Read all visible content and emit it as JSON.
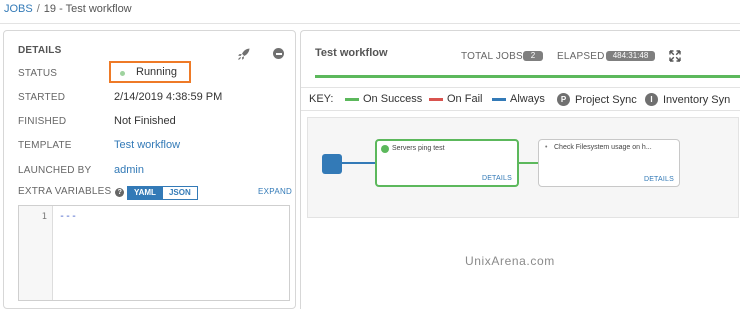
{
  "breadcrumb": {
    "root": "JOBS",
    "separator": "/",
    "current": "19 - Test workflow"
  },
  "details": {
    "title": "DETAILS",
    "status_label": "STATUS",
    "status_value": "Running",
    "started_label": "STARTED",
    "started_value": "2/14/2019 4:38:59 PM",
    "finished_label": "FINISHED",
    "finished_value": "Not Finished",
    "template_label": "TEMPLATE",
    "template_value": "Test workflow",
    "launched_by_label": "LAUNCHED BY",
    "launched_by_value": "admin",
    "extra_vars_label": "EXTRA VARIABLES",
    "help_glyph": "?",
    "yaml_label": "YAML",
    "json_label": "JSON",
    "expand_label": "EXPAND",
    "code_line_number": "1",
    "code_content": "---"
  },
  "workflow": {
    "title": "Test workflow",
    "total_jobs_label": "TOTAL JOBS",
    "total_jobs_value": "2",
    "elapsed_label": "ELAPSED",
    "elapsed_value": "484:31:48",
    "key_label": "KEY:",
    "key_items": {
      "on_success": "On Success",
      "on_fail": "On Fail",
      "always": "Always",
      "project_sync": "Project Sync",
      "inventory_sync": "Inventory Syn"
    },
    "key_glyphs": {
      "project_sync": "P",
      "inventory_sync": "I"
    },
    "nodes": [
      {
        "name": "Servers ping test",
        "details": "DETAILS"
      },
      {
        "name": "Check Filesystem usage on h...",
        "details": "DETAILS",
        "pending_glyph": "•"
      }
    ]
  },
  "watermark": "UnixArena.com",
  "colors": {
    "link": "#337ab7",
    "success": "#5cb85c",
    "fail": "#d9534f",
    "always": "#337ab7",
    "highlight": "#ee7a27",
    "status_running": "#9fd39f"
  }
}
